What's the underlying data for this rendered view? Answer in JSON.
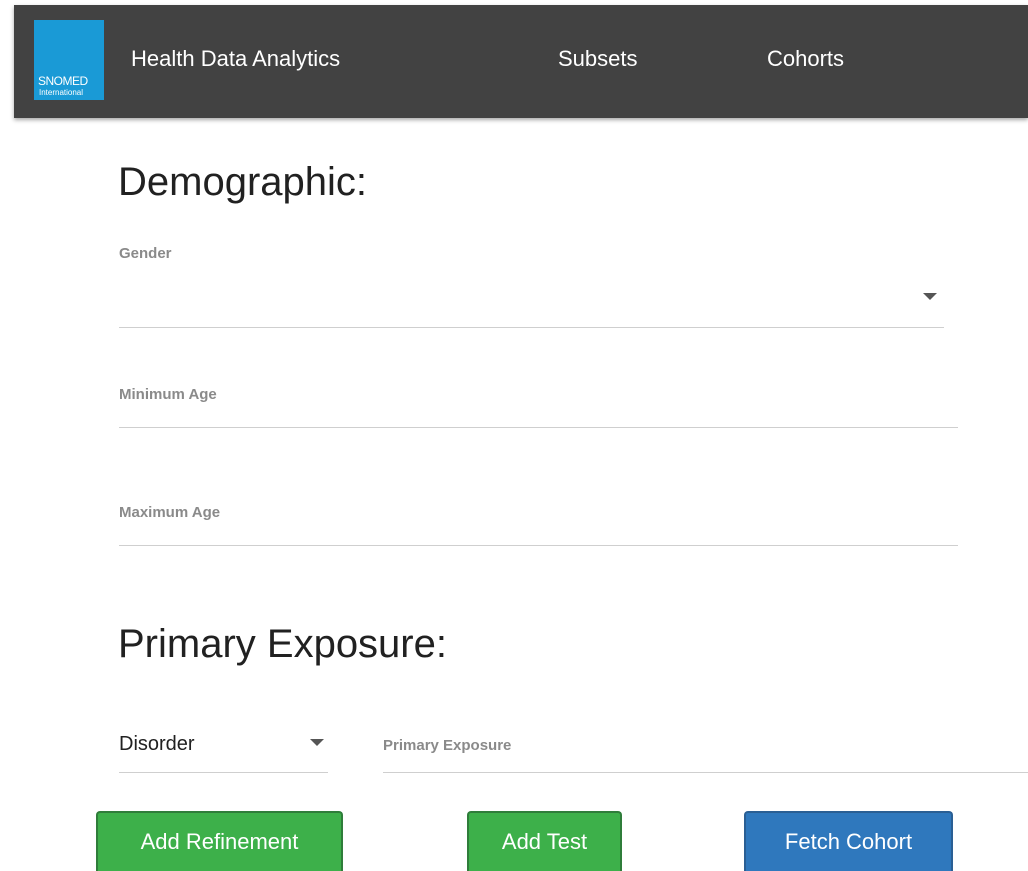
{
  "navbar": {
    "logo_line1": "SNOMED",
    "logo_line2": "International",
    "brand": "Health Data Analytics",
    "links": [
      {
        "label": "Subsets"
      },
      {
        "label": "Cohorts"
      }
    ]
  },
  "demographic": {
    "title": "Demographic:",
    "gender_label": "Gender",
    "gender_value": "",
    "min_age_label": "Minimum Age",
    "min_age_value": "",
    "max_age_label": "Maximum Age",
    "max_age_value": ""
  },
  "primary_exposure": {
    "title": "Primary Exposure:",
    "type_value": "Disorder",
    "exposure_label": "Primary Exposure",
    "exposure_value": ""
  },
  "actions": {
    "add_refinement": "Add Refinement",
    "add_test": "Add Test",
    "fetch_cohort": "Fetch Cohort"
  },
  "colors": {
    "navbar": "#424242",
    "logo": "#1a9ad6",
    "green_button": "#3db04a",
    "blue_button": "#2f78bd"
  }
}
